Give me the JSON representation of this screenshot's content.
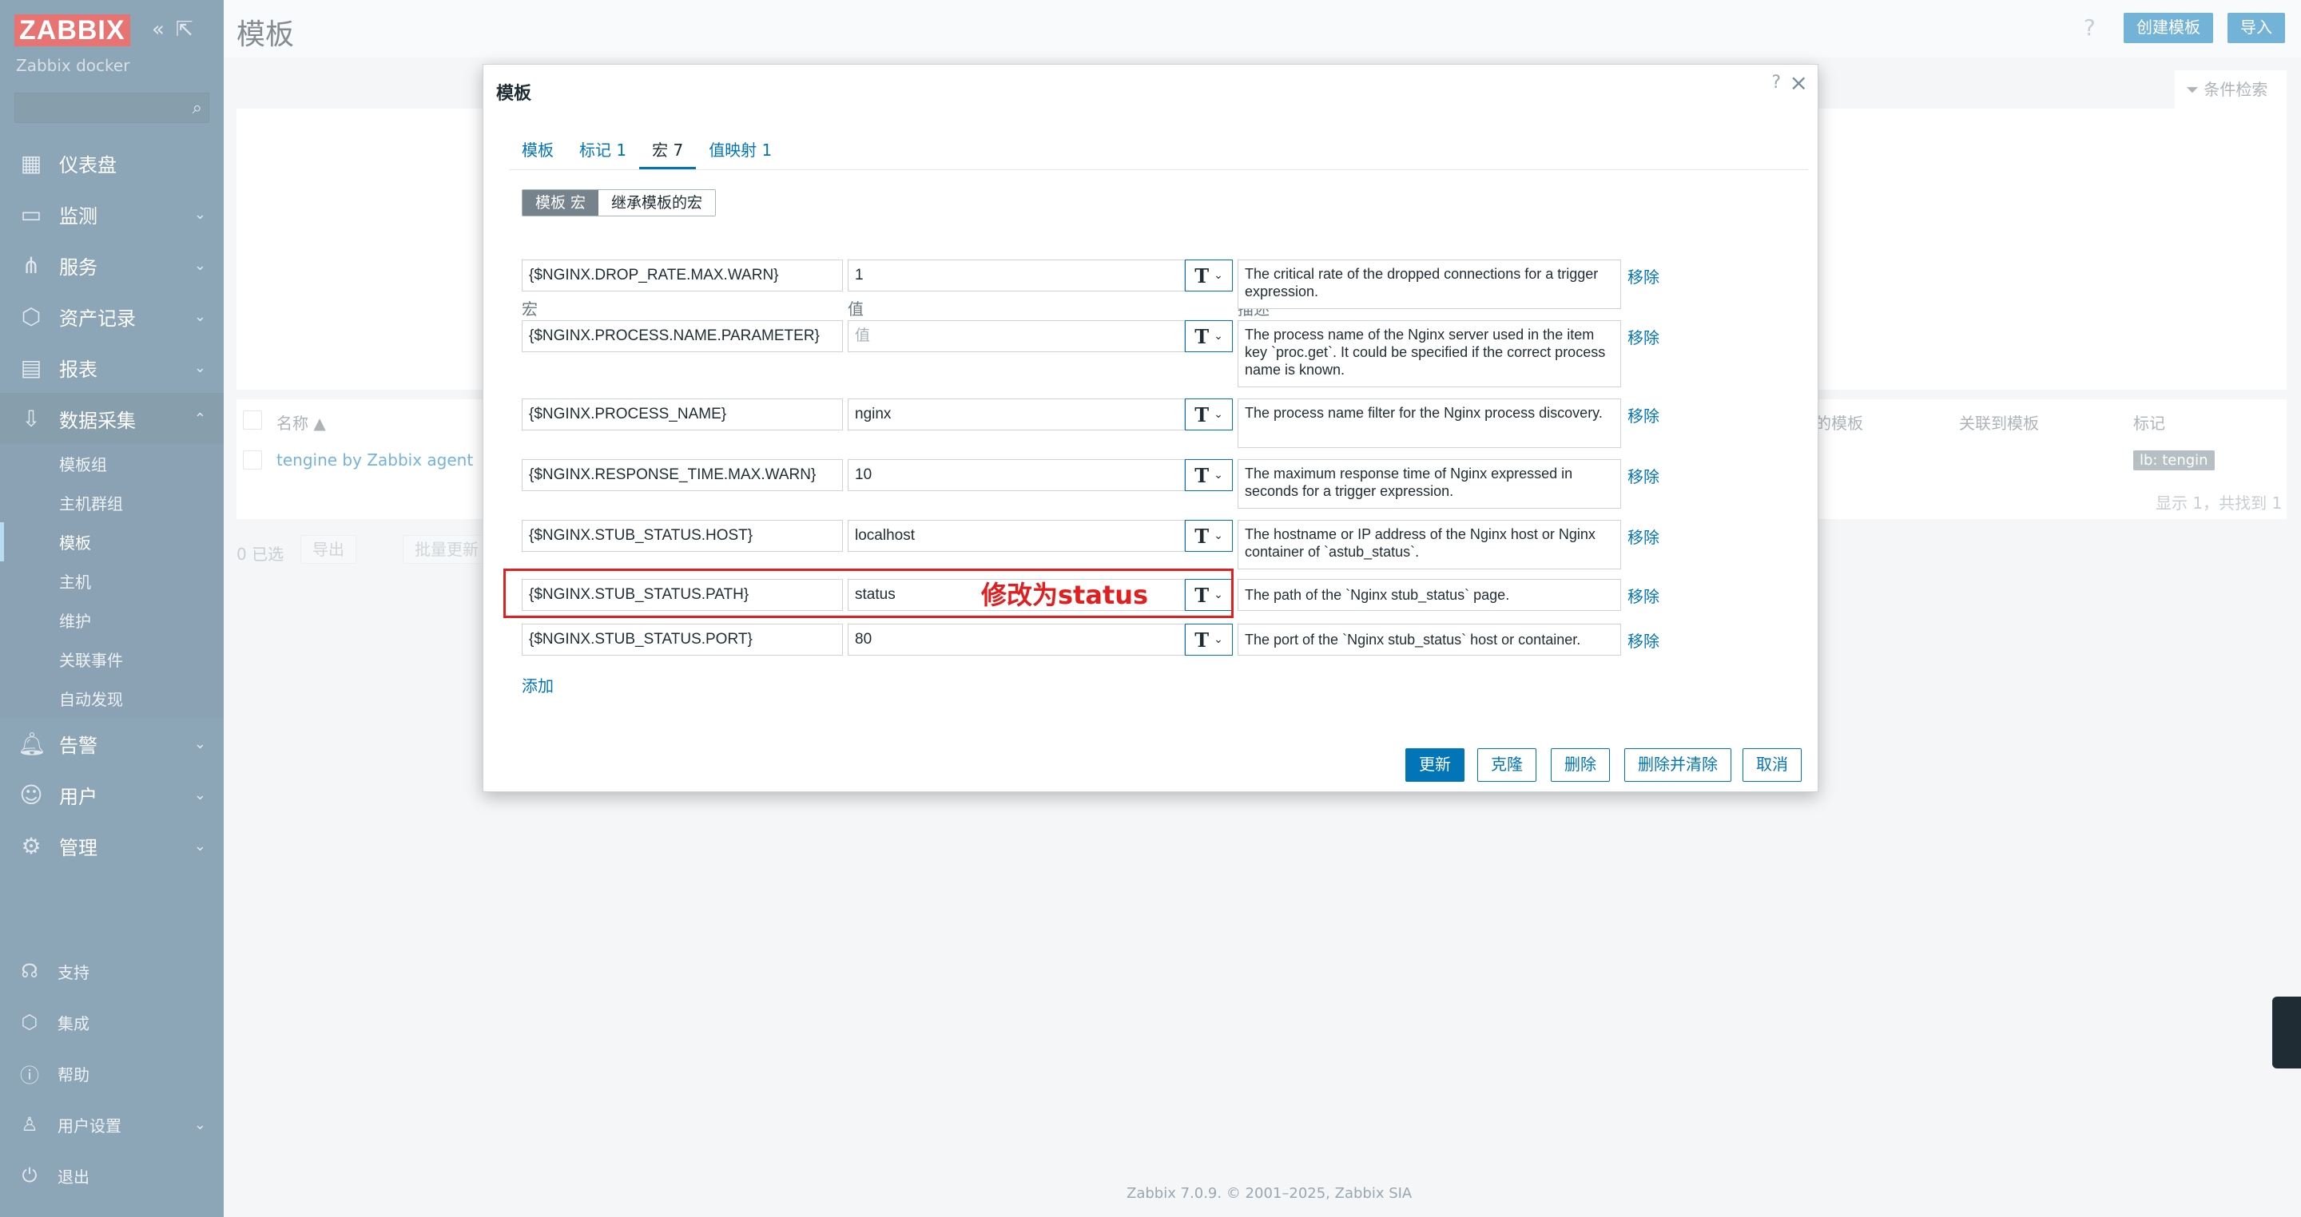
{
  "sidebar": {
    "logo": "ZABBIX",
    "server_name": "Zabbix docker",
    "menu": [
      {
        "label": "仪表盘",
        "icon": "dashboard-icon"
      },
      {
        "label": "监测",
        "icon": "monitor-icon"
      },
      {
        "label": "服务",
        "icon": "services-icon"
      },
      {
        "label": "资产记录",
        "icon": "inventory-icon"
      },
      {
        "label": "报表",
        "icon": "reports-icon"
      },
      {
        "label": "数据采集",
        "icon": "data-collection-icon"
      }
    ],
    "submenu": [
      "模板组",
      "主机群组",
      "模板",
      "主机",
      "维护",
      "关联事件",
      "自动发现"
    ],
    "menu2": [
      {
        "label": "告警",
        "icon": "bell-icon"
      },
      {
        "label": "用户",
        "icon": "users-icon"
      },
      {
        "label": "管理",
        "icon": "gear-icon"
      }
    ],
    "bottom": [
      {
        "label": "支持",
        "icon": "headset-icon"
      },
      {
        "label": "集成",
        "icon": "integration-icon"
      },
      {
        "label": "帮助",
        "icon": "help-icon"
      },
      {
        "label": "用户设置",
        "icon": "user-settings-icon"
      },
      {
        "label": "退出",
        "icon": "power-icon"
      }
    ]
  },
  "header": {
    "title": "模板",
    "help": "?",
    "create_button": "创建模板",
    "import_button": "导入"
  },
  "background": {
    "filter_label": "条件检索",
    "col_name": "名称 ▲",
    "col_linked_templates": "的模板",
    "col_linked_to": "关联到模板",
    "col_tags": "标记",
    "row_name": "tengine by Zabbix agent",
    "row_tag": "lb: tengin",
    "summary": "显示 1，共找到 1",
    "selected": "0 已选",
    "export_button": "导出",
    "mass_update_button": "批量更新"
  },
  "modal": {
    "title": "模板",
    "tabs": [
      {
        "label": "模板",
        "active": false
      },
      {
        "label": "标记 1",
        "active": false
      },
      {
        "label": "宏 7",
        "active": true
      },
      {
        "label": "值映射 1",
        "active": false
      }
    ],
    "segment": [
      "模板 宏",
      "继承模板的宏"
    ],
    "columns": {
      "macro": "宏",
      "value": "值",
      "description": "描述"
    },
    "macros": [
      {
        "macro": "{$NGINX.DROP_RATE.MAX.WARN}",
        "value": "1",
        "value_placeholder": false,
        "description": "The critical rate of the dropped connections for a trigger expression."
      },
      {
        "macro": "{$NGINX.PROCESS.NAME.PARAMETER}",
        "value": "值",
        "value_placeholder": true,
        "description": "The process name of the Nginx server used in the item key `proc.get`. It could be specified if the correct process name is known."
      },
      {
        "macro": "{$NGINX.PROCESS_NAME}",
        "value": "nginx",
        "value_placeholder": false,
        "description": "The process name filter for the Nginx process discovery."
      },
      {
        "macro": "{$NGINX.RESPONSE_TIME.MAX.WARN}",
        "value": "10",
        "value_placeholder": false,
        "description": "The maximum response time of Nginx expressed in seconds for a trigger expression."
      },
      {
        "macro": "{$NGINX.STUB_STATUS.HOST}",
        "value": "localhost",
        "value_placeholder": false,
        "description": "The hostname or IP address of the Nginx host or Nginx container of `astub_status`."
      },
      {
        "macro": "{$NGINX.STUB_STATUS.PATH}",
        "value": "status",
        "value_placeholder": false,
        "description": "The path of the `Nginx stub_status` page."
      },
      {
        "macro": "{$NGINX.STUB_STATUS.PORT}",
        "value": "80",
        "value_placeholder": false,
        "description": "The port of the `Nginx stub_status` host or container."
      }
    ],
    "type_glyph": "T",
    "remove_label": "移除",
    "add_label": "添加",
    "annotation": "修改为status",
    "buttons": {
      "update": "更新",
      "clone": "克隆",
      "delete": "删除",
      "delete_clear": "删除并清除",
      "cancel": "取消"
    }
  },
  "footer": "Zabbix 7.0.9. © 2001–2025, Zabbix SIA",
  "colors": {
    "sidebar": "#2f5d7c",
    "accent": "#0275b8",
    "annotation": "#e02020"
  }
}
